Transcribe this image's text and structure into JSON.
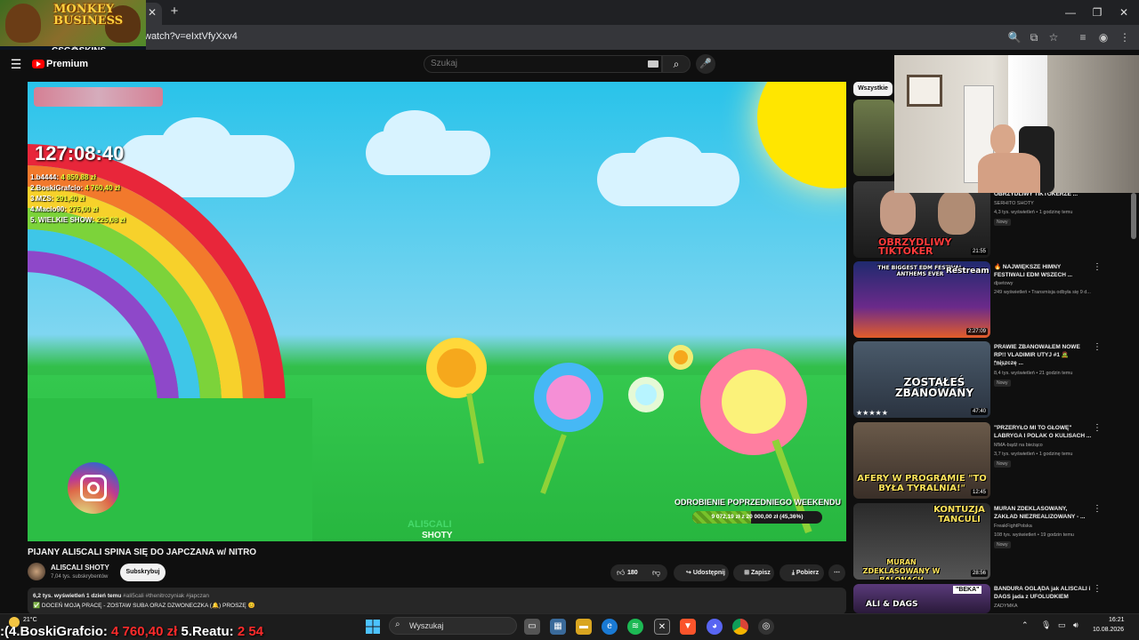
{
  "browser": {
    "url": "watch?v=eIxtVfyXxv4",
    "tab_close": "✕",
    "new_tab": "+"
  },
  "overlay": {
    "logo_text": "MONKEY BUSINESS",
    "sponsor_text": "CSG⚙SKINS"
  },
  "header": {
    "premium_label": "Premium",
    "search_placeholder": "Szukaj"
  },
  "video": {
    "timer": "127:08:40",
    "leaderboard": [
      {
        "name": "1.b4444:",
        "amount": "4 859,88 zł"
      },
      {
        "name": "2.BoskiGrafcio:",
        "amount": "4 760,40 zł"
      },
      {
        "name": "3.MZS:",
        "amount": "291,40 zł"
      },
      {
        "name": "4.Macio90:",
        "amount": "275,00 zł"
      },
      {
        "name": "5. WIELKIE SHOW:",
        "amount": "225,08 zł"
      }
    ],
    "goal_title": "ODROBIENIE POPRZEDNIEGO WEEKENDU",
    "goal_text": "9 072,19 zł z 20 000,00 zł (45,36%)",
    "goal_progress": 0.4536,
    "watermark_1": "ALI5CALI",
    "watermark_2": "SHOTY",
    "title": "PIJANY ALI5CALI SPINA SIĘ DO JAPCZANA w/ NITRO"
  },
  "channel": {
    "name": "ALI5CALI SHOTY",
    "subscribers": "7,04 tys. subskrybentów",
    "subscribe_label": "Subskrybuj"
  },
  "actions": {
    "likes": "180",
    "share": "Udostępnij",
    "save": "Zapisz",
    "download": "Pobierz"
  },
  "description": {
    "views": "6,2 tys. wyświetleń",
    "date": "1 dzień temu",
    "tags": "#ali5cali #thenitrozyniak #japczan",
    "line2": "✅ DOCEŃ MOJĄ PRACĘ - ZOSTAW SUBA ORAZ DZWONECZKA (🔔) PROSZĘ 😊"
  },
  "sidebar": {
    "chip_all": "Wszystkie",
    "recommendations": [
      {
        "title": "OBRZYDLIWY TIKTOKERZE ...",
        "channel": "SERHITO SHOTY",
        "meta": "4,3 tys. wyświetleń • 1 godzinę temu",
        "badge": "Nowy",
        "duration": "21:55",
        "thumb_text": "OBRZYDLIWY TIKTOKER"
      },
      {
        "title": "🔥 NAJWIĘKSZE HIMNY FESTIWALI EDM WSZECH ...",
        "channel": "djsetowy",
        "meta": "249 wyświetleń • Transmisja odbyła się 9 d...",
        "badge": "",
        "duration": "2:27:09",
        "thumb_text": "THE BIGGEST EDM FESTIVAL ANTHEMS EVER"
      },
      {
        "title": "PRAWIE ZBANOWAŁEM NOWE RP!! VLADIMIR UTYJ #1 🧟 *niszczę ...",
        "channel": "LeQu",
        "meta": "8,4 tys. wyświetleń • 21 godzin temu",
        "badge": "Nowy",
        "duration": "47:40",
        "thumb_text": "ZOSTAŁEŚ ZBANOWANY"
      },
      {
        "title": "\"PRZERYŁO MI TO GŁOWĘ\" LABRYGA I POLAK O KULISACH ...",
        "channel": "MMA-bądź na bieżąco",
        "meta": "3,7 tys. wyświetleń • 1 godzinę temu",
        "badge": "Nowy",
        "duration": "12:45",
        "thumb_text": "AFERY W PROGRAMIE \"TO BYŁA TYRALNIA!\""
      },
      {
        "title": "MURAN ZDEKLASOWANY, ZAKŁAD NIEZREALIZOWANY - ...",
        "channel": "FreakFightPolska",
        "meta": "108 tys. wyświetleń • 19 godzin temu",
        "badge": "Nowy",
        "duration": "28:56",
        "thumb_text": "MURAN ZDEKLASOWANY W BALONACH"
      },
      {
        "title": "BANDURA OGLĄDA jak ALISCALI i DAGS jada z UFOLUDKIEM",
        "channel": "ZADYMKA",
        "meta": "",
        "badge": "",
        "duration": "",
        "thumb_text": "ALI & DAGS"
      }
    ],
    "thumb2_overlay": "Restream",
    "thumb4_overlay2": "KONTUZJA TANCULI",
    "thumb5_overlay": "\"BEKA\""
  },
  "taskbar": {
    "weather": "21°C",
    "ticker_prefix": ":(",
    "ticker_name1": "4.BoskiGrafcio:",
    "ticker_amount1": "4 760,40 zł",
    "ticker_name2": "5.Reatu:",
    "ticker_amount2": "2 54",
    "search_label": "Wyszukaj",
    "time": "16:21",
    "date": "10.08.2026"
  }
}
